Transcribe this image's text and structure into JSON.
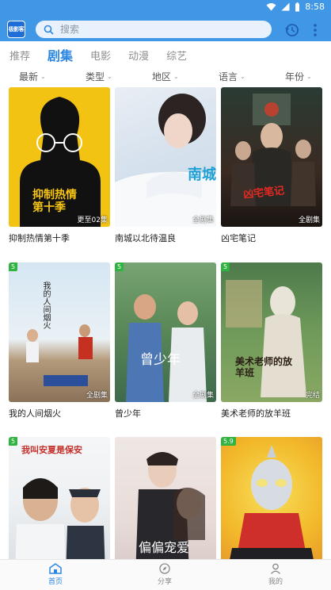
{
  "status_bar": {
    "time": "8:58"
  },
  "app": {
    "logo_text": "极影客"
  },
  "search": {
    "placeholder": "搜索"
  },
  "tabs": [
    {
      "label": "推荐",
      "active": false
    },
    {
      "label": "剧集",
      "active": true
    },
    {
      "label": "电影",
      "active": false
    },
    {
      "label": "动漫",
      "active": false
    },
    {
      "label": "综艺",
      "active": false
    }
  ],
  "filters": [
    {
      "label": "最新"
    },
    {
      "label": "类型"
    },
    {
      "label": "地区"
    },
    {
      "label": "语言"
    },
    {
      "label": "年份"
    }
  ],
  "cards": [
    {
      "title": "抑制热情第十季",
      "badge": "更至02集",
      "score": "",
      "poster_text": "抑制热情\n第十季"
    },
    {
      "title": "南城以北待温良",
      "badge": "全剧集",
      "score": "",
      "poster_text": "南城"
    },
    {
      "title": "凶宅笔记",
      "badge": "全剧集",
      "score": "",
      "poster_text": "凶宅笔记"
    },
    {
      "title": "我的人间烟火",
      "badge": "全剧集",
      "score": "5",
      "poster_text": "我的人间烟火"
    },
    {
      "title": "曾少年",
      "badge": "全剧集",
      "score": "5",
      "poster_text": "曾少年"
    },
    {
      "title": "美术老师的放羊班",
      "badge": "完结",
      "score": "5",
      "poster_text": "美术老师的放羊班"
    },
    {
      "title": "",
      "badge": "",
      "score": "5",
      "poster_text": "我叫安夏是保安"
    },
    {
      "title": "",
      "badge": "",
      "score": "",
      "poster_text": "偏偏宠爱"
    },
    {
      "title": "",
      "badge": "",
      "score": "5.9",
      "poster_text": ""
    }
  ],
  "bottom_nav": [
    {
      "label": "首页",
      "active": true
    },
    {
      "label": "分享",
      "active": false
    },
    {
      "label": "我的",
      "active": false
    }
  ]
}
